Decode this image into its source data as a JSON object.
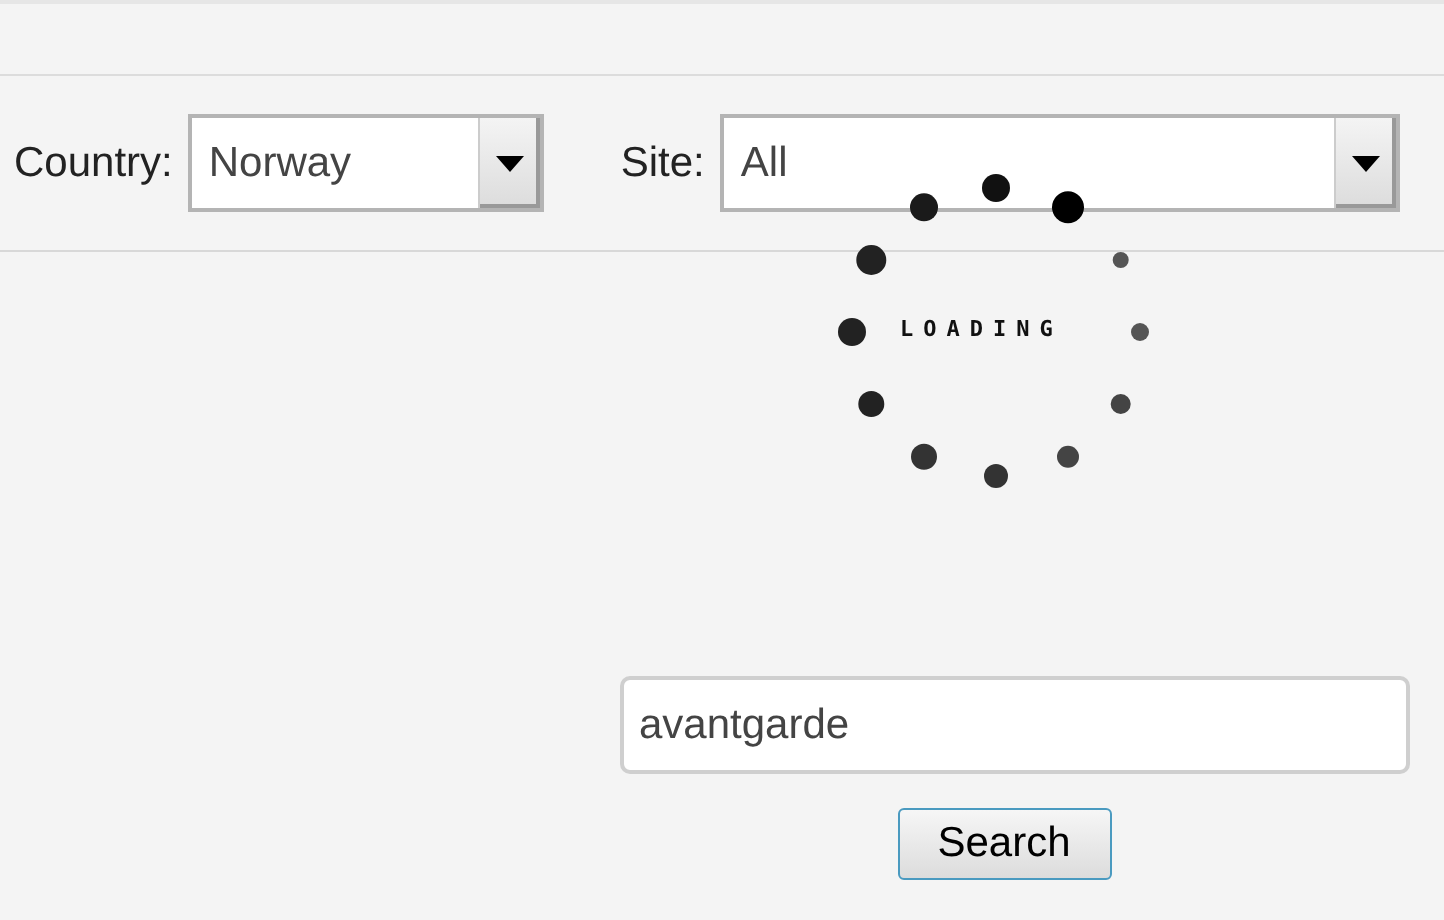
{
  "filters": [
    {
      "label": "Country:",
      "value": "Norway"
    },
    {
      "label": "Site:",
      "value": "All"
    }
  ],
  "loading": {
    "label": "LOADING"
  },
  "search": {
    "value": "avantgarde",
    "button": "Search"
  }
}
